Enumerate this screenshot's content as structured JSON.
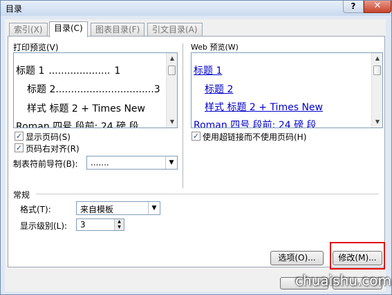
{
  "window": {
    "title": "目录",
    "help": "?",
    "close": "✕"
  },
  "tabs": [
    {
      "label": "索引(X)"
    },
    {
      "label": "目录(C)"
    },
    {
      "label": "图表目录(F)"
    },
    {
      "label": "引文目录(A)"
    }
  ],
  "print_preview": {
    "label": "打印预览(V)",
    "lines": [
      {
        "text": "标题 1",
        "dots": "....................",
        "page": "1"
      },
      {
        "text": "标题 2",
        "dots": "................................",
        "page": "3"
      },
      {
        "text": "样式 标题 2 + Times New"
      },
      {
        "text": "Roman 四号 段前: 24 磅 段"
      }
    ]
  },
  "web_preview": {
    "label": "Web 预览(W)",
    "lines": [
      {
        "text": "标题 1"
      },
      {
        "text": "标题 2"
      },
      {
        "text": "样式 标题 2 + Times New"
      },
      {
        "text": "Roman 四号 段前: 24 磅 段"
      }
    ]
  },
  "options": {
    "show_page_numbers": {
      "label": "显示页码(S)",
      "checked": true
    },
    "right_align": {
      "label": "页码右对齐(R)",
      "checked": true
    },
    "tab_leader": {
      "label": "制表符前导符(B):",
      "value": "......."
    },
    "use_hyperlinks": {
      "label": "使用超链接而不使用页码(H)",
      "checked": true
    }
  },
  "general": {
    "group_label": "常规",
    "format": {
      "label": "格式(T):",
      "value": "来自模板"
    },
    "levels": {
      "label": "显示级别(L):",
      "value": "3"
    }
  },
  "buttons": {
    "options": "选项(O)...",
    "modify": "修改(M)..."
  },
  "watermark": "chuaishu.com",
  "colors": {
    "link": "#0000cc",
    "highlight": "#e00000"
  }
}
